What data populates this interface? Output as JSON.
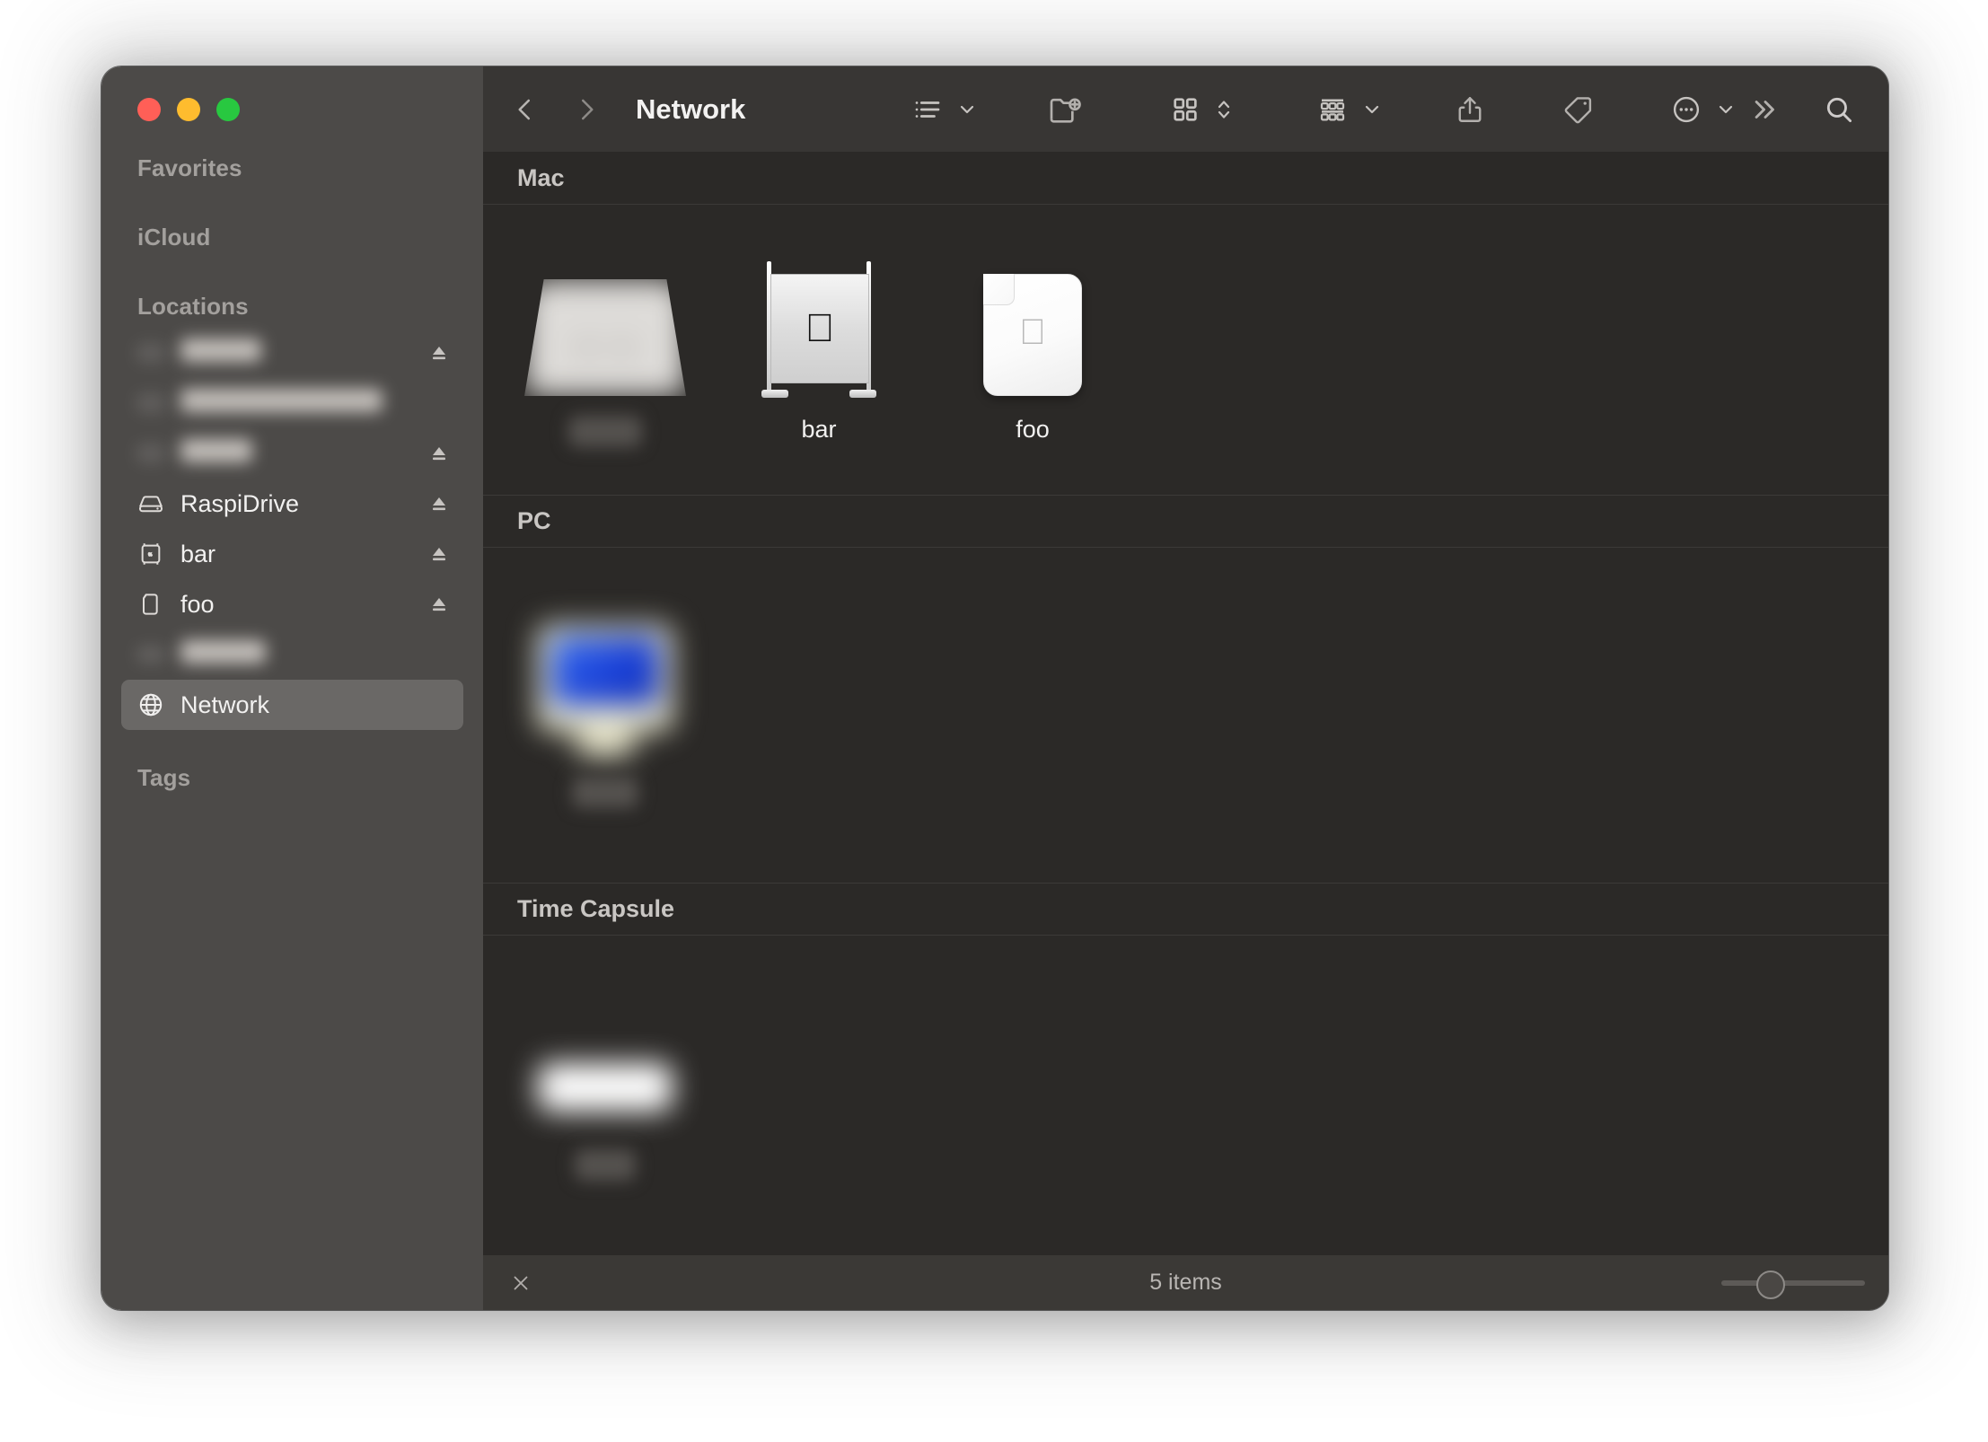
{
  "window": {
    "title": "Network",
    "traffic_lights": [
      {
        "name": "close",
        "color": "#ff5f57"
      },
      {
        "name": "minimize",
        "color": "#febc2e"
      },
      {
        "name": "zoom",
        "color": "#28c840"
      }
    ]
  },
  "sidebar": {
    "sections": [
      {
        "title": "Favorites",
        "items": []
      },
      {
        "title": "iCloud",
        "items": []
      },
      {
        "title": "Locations",
        "items": [
          {
            "label": "",
            "icon": "disk-icon",
            "eject": true,
            "blurred": true,
            "blur_width": 90
          },
          {
            "label": "",
            "icon": "disk-icon",
            "eject": false,
            "blurred": true,
            "blur_width": 225
          },
          {
            "label": "",
            "icon": "disk-icon",
            "eject": true,
            "blurred": true,
            "blur_width": 80
          },
          {
            "label": "RaspiDrive",
            "icon": "external-drive-icon",
            "eject": true,
            "blurred": false
          },
          {
            "label": "bar",
            "icon": "mac-pro-icon",
            "eject": true,
            "blurred": false
          },
          {
            "label": "foo",
            "icon": "device-icon",
            "eject": true,
            "blurred": false
          },
          {
            "label": "",
            "icon": "disk-icon",
            "eject": false,
            "blurred": true,
            "blur_width": 95
          },
          {
            "label": "Network",
            "icon": "globe-icon",
            "eject": false,
            "blurred": false,
            "selected": true
          }
        ]
      },
      {
        "title": "Tags",
        "items": []
      }
    ]
  },
  "toolbar": {
    "back_label": "Back",
    "forward_label": "Forward",
    "title": "Network",
    "buttons": [
      {
        "name": "list-view-icon",
        "label": "View options",
        "has_chevron": true
      },
      {
        "name": "new-folder-icon",
        "label": "New Folder",
        "has_chevron": false
      },
      {
        "name": "icon-view-icon",
        "label": "Icon size",
        "has_chevron": false
      },
      {
        "name": "group-by-icon",
        "label": "Group by",
        "has_chevron": true
      },
      {
        "name": "share-icon",
        "label": "Share",
        "has_chevron": false
      },
      {
        "name": "tag-icon",
        "label": "Tags",
        "has_chevron": false
      },
      {
        "name": "more-actions-icon",
        "label": "More",
        "has_chevron": true
      },
      {
        "name": "overflow-icon",
        "label": "More toolbar items",
        "has_chevron": false
      },
      {
        "name": "search-icon",
        "label": "Search",
        "has_chevron": false
      }
    ]
  },
  "content": {
    "groups": [
      {
        "title": "Mac",
        "items": [
          {
            "label": "",
            "icon": "mac-blurred-icon",
            "blurred": true
          },
          {
            "label": "bar",
            "icon": "mac-pro-icon",
            "blurred": false
          },
          {
            "label": "foo",
            "icon": "apple-device-icon",
            "blurred": false
          }
        ]
      },
      {
        "title": "PC",
        "items": [
          {
            "label": "",
            "icon": "crt-monitor-icon",
            "blurred": true
          }
        ]
      },
      {
        "title": "Time Capsule",
        "items": [
          {
            "label": "",
            "icon": "time-capsule-icon",
            "blurred": true
          }
        ]
      }
    ]
  },
  "statusbar": {
    "close_label": "Close",
    "item_count": "5 items",
    "zoom_value": 33
  },
  "colors": {
    "sidebar_bg": "#4c4a48",
    "main_bg": "#2b2927",
    "toolbar_bg": "#383634",
    "statusbar_bg": "#3b3936",
    "selection": "#6a6866",
    "text_primary": "#f2f1f0",
    "text_secondary": "#a3a09d",
    "pc_screen_blue": "#1b42d8"
  }
}
